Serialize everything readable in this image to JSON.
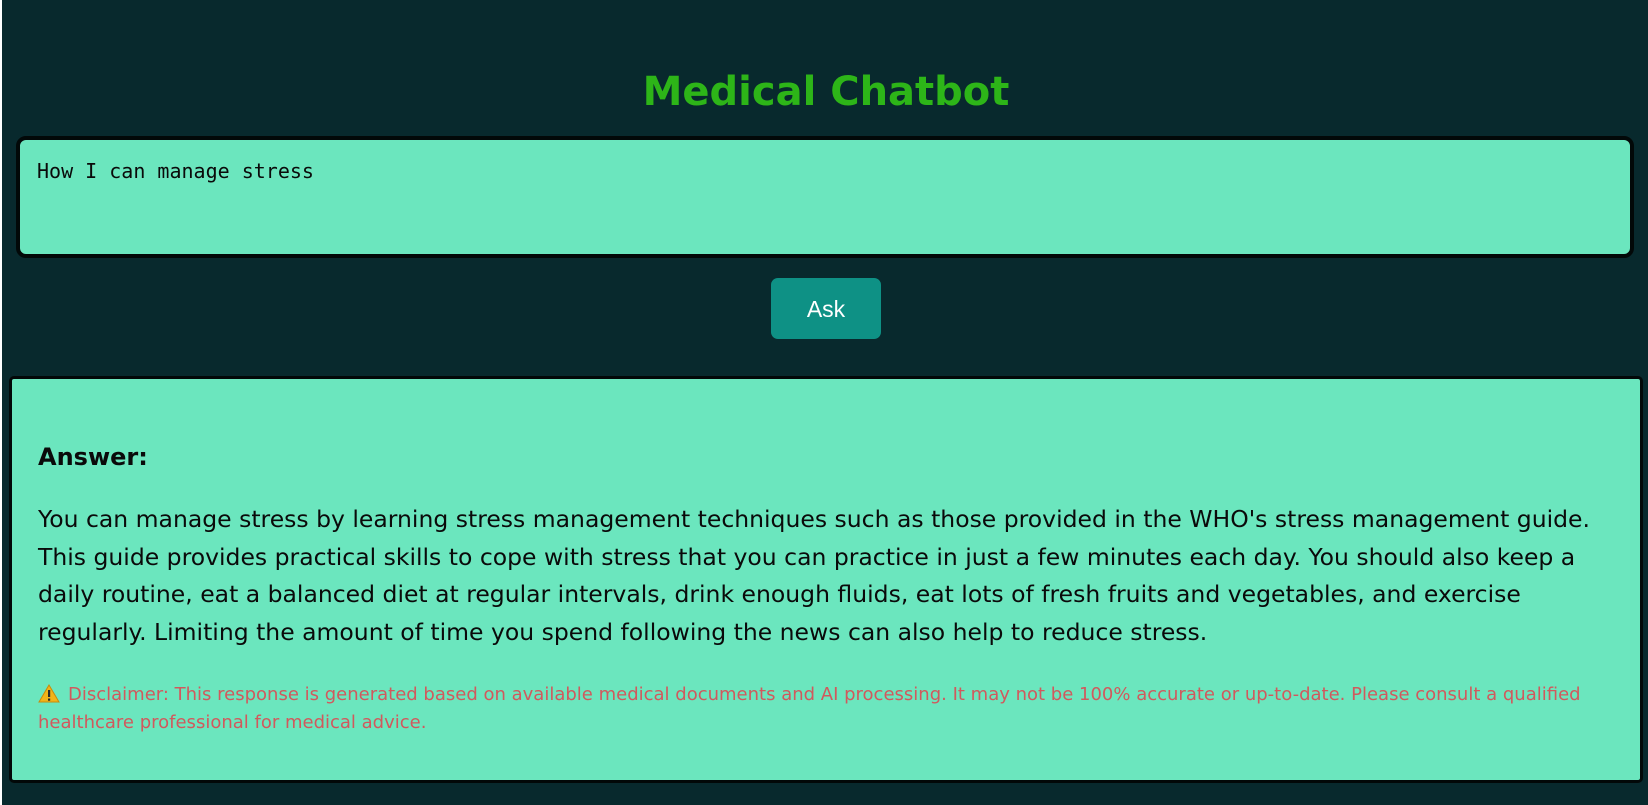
{
  "header": {
    "title": "Medical Chatbot"
  },
  "question": {
    "value": "How I can manage stress"
  },
  "ask_button": {
    "label": "Ask"
  },
  "answer": {
    "heading": "Answer:",
    "text": "You can manage stress by learning stress management techniques such as those provided in the WHO's stress management guide. This guide provides practical skills to cope with stress that you can practice in just a few minutes each day. You should also keep a daily routine, eat a balanced diet at regular intervals, drink enough fluids, eat lots of fresh fruits and vegetables, and exercise regularly. Limiting the amount of time you spend following the news can also help to reduce stress.",
    "disclaimer": "Disclaimer: This response is generated based on available medical documents and AI processing. It may not be 100% accurate or up-to-date. Please consult a qualified healthcare professional for medical advice.",
    "disclaimer_icon": "warning-icon"
  },
  "colors": {
    "background": "#08292d",
    "title": "#2db518",
    "panel": "#6be6be",
    "button": "#0e9185",
    "disclaimer": "#d1595d"
  }
}
